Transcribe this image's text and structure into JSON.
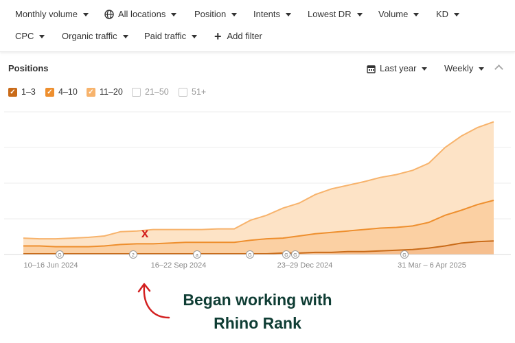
{
  "filters": {
    "monthly_volume": "Monthly volume",
    "all_locations": "All locations",
    "position": "Position",
    "intents": "Intents",
    "lowest_dr": "Lowest DR",
    "volume": "Volume",
    "kd": "KD",
    "cpc": "CPC",
    "organic_traffic": "Organic traffic",
    "paid_traffic": "Paid traffic",
    "add_filter": "Add filter"
  },
  "panel": {
    "title": "Positions",
    "date_range": "Last year",
    "granularity": "Weekly"
  },
  "legend": [
    {
      "label": "1–3",
      "checked": true,
      "color": "#c96b19"
    },
    {
      "label": "4–10",
      "checked": true,
      "color": "#ee8f2e"
    },
    {
      "label": "11–20",
      "checked": true,
      "color": "#f7b36c"
    },
    {
      "label": "21–50",
      "checked": false,
      "color": "#ffffff"
    },
    {
      "label": "51+",
      "checked": false,
      "color": "#ffffff"
    }
  ],
  "chart_data": {
    "type": "area",
    "x": [
      "10–16 Jun 2024",
      "16–22 Sep 2024",
      "23–29 Dec 2024",
      "31 Mar – 6 Apr 2025"
    ],
    "xlabels": [
      "10–16 Jun 2024",
      "16–22 Sep 2024",
      "23–29 Dec 2024",
      "31 Mar – 6 Apr 2025"
    ],
    "series": [
      {
        "name": "11–20",
        "color": "#f9cc98",
        "values": [
          23,
          22,
          22,
          23,
          24,
          26,
          32,
          33,
          35,
          35,
          35,
          35,
          36,
          36,
          48,
          55,
          65,
          72,
          84,
          92,
          97,
          102,
          108,
          112,
          118,
          128,
          150,
          166,
          178,
          186
        ]
      },
      {
        "name": "4–10",
        "color": "#f4a259",
        "values": [
          12,
          12,
          11,
          11,
          11,
          12,
          14,
          15,
          15,
          16,
          17,
          17,
          17,
          17,
          20,
          22,
          23,
          26,
          29,
          31,
          33,
          35,
          37,
          38,
          40,
          45,
          55,
          62,
          70,
          76
        ]
      },
      {
        "name": "1–3",
        "color": "#d27a29",
        "values": [
          1,
          1,
          1,
          1,
          1,
          1,
          1,
          1,
          1,
          1,
          1,
          1,
          1,
          1,
          1,
          1,
          2,
          2,
          3,
          3,
          4,
          4,
          5,
          6,
          7,
          9,
          12,
          16,
          18,
          19
        ]
      }
    ],
    "ylim": [
      0,
      200
    ],
    "grid": true
  },
  "markers": [
    "G",
    "2",
    "a",
    "G",
    "G",
    "G",
    "G"
  ],
  "x_mark": "x",
  "annotation": {
    "line1": "Began working with",
    "line2": "Rhino Rank"
  }
}
